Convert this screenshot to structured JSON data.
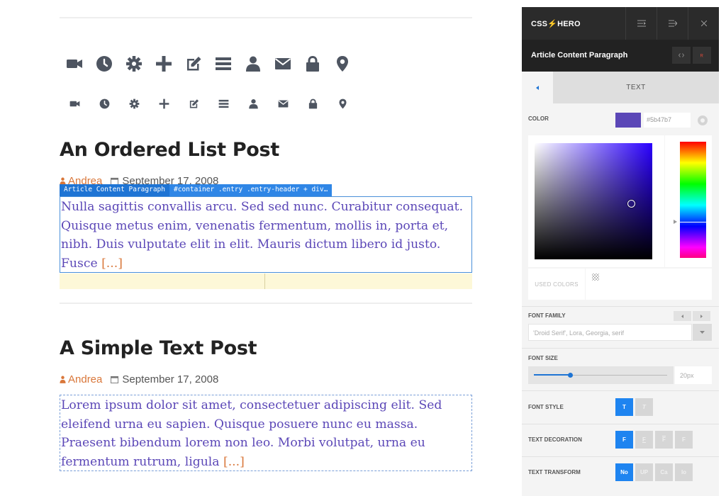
{
  "posts": [
    {
      "title": "An Ordered List Post",
      "author": "Andrea",
      "date": "September 17, 2008",
      "excerpt": "Nulla sagittis convallis arcu. Sed sed nunc. Curabitur consequat. Quisque metus enim, venenatis fermentum, mollis in, porta et, nibh. Duis vulputate elit in elit. Mauris dictum libero id justo. Fusce",
      "more": "[...]"
    },
    {
      "title": "A Simple Text Post",
      "author": "Andrea",
      "date": "September 17, 2008",
      "excerpt": "Lorem ipsum dolor sit amet, consectetuer adipiscing elit. Sed eleifend urna eu sapien. Quisque posuere nunc eu massa. Praesent bibendum lorem non leo. Morbi volutpat, urna eu fermentum rutrum, ligula",
      "more": "[...]"
    }
  ],
  "icon_rows": [
    [
      "video-camera-icon",
      "clock-icon",
      "gear-icon",
      "plus-icon",
      "edit-icon",
      "list-icon",
      "user-icon",
      "envelope-icon",
      "lock-icon",
      "map-marker-icon"
    ],
    [
      "video-camera-icon",
      "clock-icon",
      "gear-icon",
      "plus-icon",
      "edit-icon",
      "list-icon",
      "user-icon",
      "envelope-icon",
      "lock-icon",
      "map-marker-icon"
    ]
  ],
  "selection": {
    "element_name": "Article Content Paragraph",
    "selector": "#container .entry .entry-header + div…"
  },
  "panel": {
    "logo": "CSS⚡HERO",
    "element_title": "Article Content Paragraph",
    "tab_label": "TEXT",
    "color": {
      "label": "COLOR",
      "value": "#5b47b7",
      "saturation": 0.82,
      "brightness": 0.48,
      "hue_position": 0.69
    },
    "used_colors_label": "USED COLORS",
    "font_family": {
      "label": "FONT FAMILY",
      "value": "'Droid Serif', Lora, Georgia, serif"
    },
    "font_size": {
      "label": "FONT SIZE",
      "value": "20px",
      "slider_fraction": 0.27
    },
    "font_style": {
      "label": "FONT STYLE",
      "options": [
        "T",
        "T"
      ],
      "active": 0
    },
    "text_decoration": {
      "label": "TEXT DECORATION",
      "options": [
        "F",
        "F",
        "F",
        "F"
      ],
      "active": 0
    },
    "text_transform": {
      "label": "TEXT TRANSFORM",
      "options": [
        "No",
        "UP",
        "Ca",
        "lo"
      ],
      "active": 0
    },
    "accent_color": "#1e84f0"
  }
}
